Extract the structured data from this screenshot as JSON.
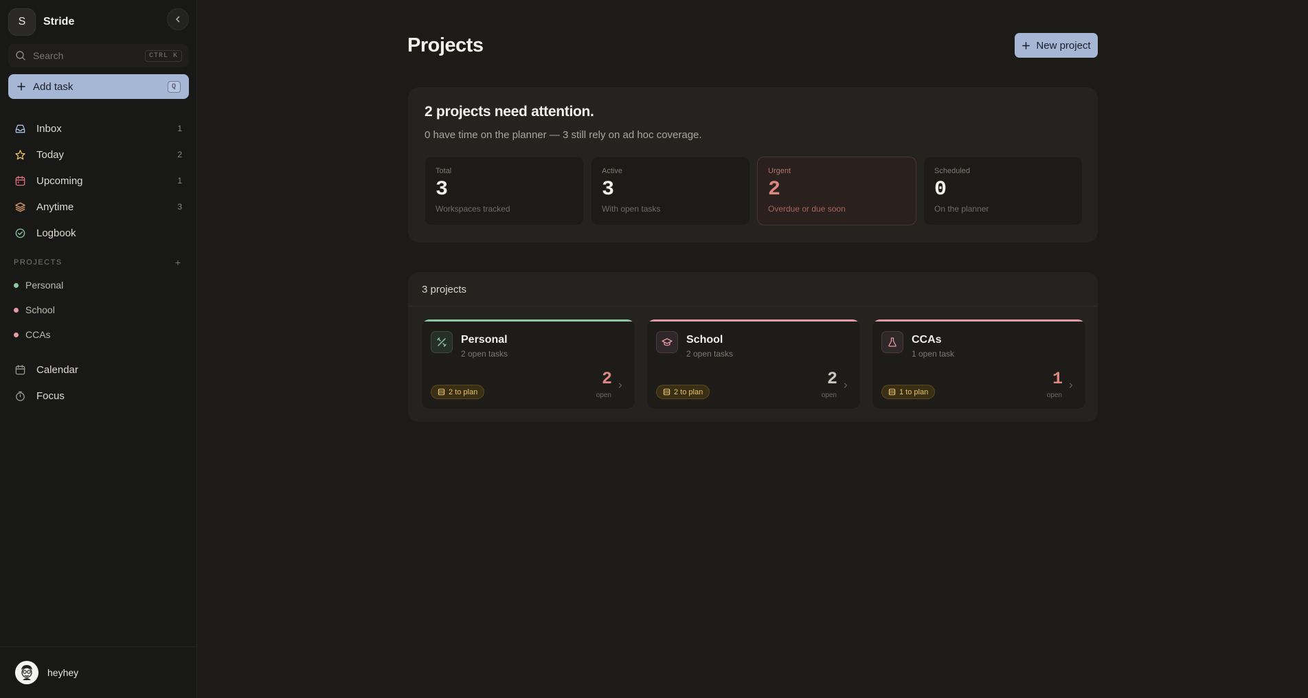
{
  "brand": {
    "initial": "S",
    "name": "Stride"
  },
  "search": {
    "placeholder": "Search",
    "shortcut": "CTRL K"
  },
  "add_task": {
    "label": "Add task",
    "shortcut": "Q"
  },
  "nav": [
    {
      "label": "Inbox",
      "count": "1",
      "icon": "inbox-icon"
    },
    {
      "label": "Today",
      "count": "2",
      "icon": "star-icon"
    },
    {
      "label": "Upcoming",
      "count": "1",
      "icon": "calendar-icon"
    },
    {
      "label": "Anytime",
      "count": "3",
      "icon": "layers-icon"
    },
    {
      "label": "Logbook",
      "count": "",
      "icon": "check-circle-icon"
    }
  ],
  "projects_section": {
    "title": "PROJECTS",
    "add": "+"
  },
  "sidebar_projects": [
    {
      "label": "Personal",
      "color": "#8fc7a4"
    },
    {
      "label": "School",
      "color": "#e59aa6"
    },
    {
      "label": "CCAs",
      "color": "#e59aa6"
    }
  ],
  "nav2": [
    {
      "label": "Calendar",
      "icon": "calendar-icon"
    },
    {
      "label": "Focus",
      "icon": "timer-icon"
    }
  ],
  "user": {
    "name": "heyhey"
  },
  "page": {
    "title": "Projects",
    "new_project_label": "New project"
  },
  "summary": {
    "title": "2 projects need attention.",
    "subtitle": "0 have time on the planner — 3 still rely on ad hoc coverage.",
    "stats": [
      {
        "label": "Total",
        "value": "3",
        "desc": "Workspaces tracked"
      },
      {
        "label": "Active",
        "value": "3",
        "desc": "With open tasks"
      },
      {
        "label": "Urgent",
        "value": "2",
        "desc": "Overdue or due soon"
      },
      {
        "label": "Scheduled",
        "value": "0",
        "desc": "On the planner"
      }
    ]
  },
  "project_list": {
    "heading": "3 projects",
    "cards": [
      {
        "name": "Personal",
        "sub": "2 open tasks",
        "badge": "2 to plan",
        "count": "2",
        "count_label": "open",
        "accent": "#8fc7a4",
        "icon": "tools-icon",
        "count_color": "#d98880"
      },
      {
        "name": "School",
        "sub": "2 open tasks",
        "badge": "2 to plan",
        "count": "2",
        "count_label": "open",
        "accent": "#e59aa6",
        "icon": "graduation-cap-icon",
        "count_color": "#c9c6bf"
      },
      {
        "name": "CCAs",
        "sub": "1 open task",
        "badge": "1 to plan",
        "count": "1",
        "count_label": "open",
        "accent": "#e59aa6",
        "icon": "flask-icon",
        "count_color": "#d98880"
      }
    ]
  },
  "colors": {
    "accent": "#a6b7d6",
    "urgent": "#d98880",
    "badge": "#e8c26a"
  }
}
